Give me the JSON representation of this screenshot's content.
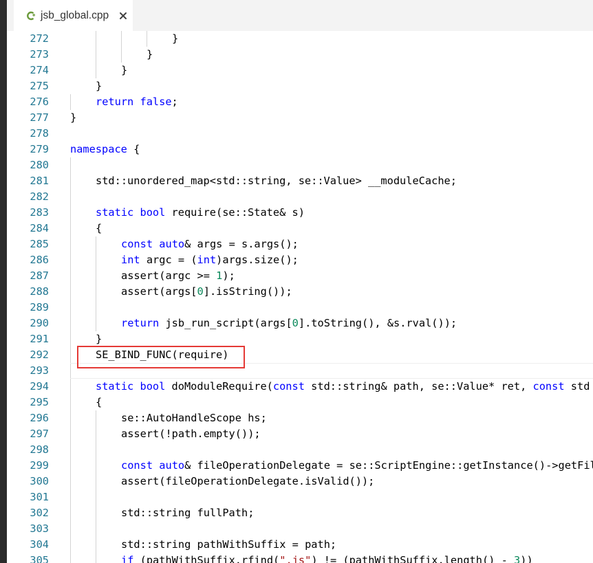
{
  "tab": {
    "filename": "jsb_global.cpp",
    "icon": "cpp-file-icon",
    "close_icon": "close-icon"
  },
  "colors": {
    "keyword": "#0000ff",
    "number": "#09885a",
    "string": "#a31515",
    "line_number": "#237893",
    "highlight_box": "#e53935"
  },
  "editor": {
    "highlighted_line": 292,
    "lines": [
      {
        "n": "272",
        "indent": 4,
        "t": [
          [
            "}",
            ""
          ]
        ]
      },
      {
        "n": "273",
        "indent": 3,
        "t": [
          [
            "}",
            ""
          ]
        ]
      },
      {
        "n": "274",
        "indent": 2,
        "t": [
          [
            "}",
            ""
          ]
        ]
      },
      {
        "n": "275",
        "indent": 1,
        "t": [
          [
            "}",
            ""
          ]
        ]
      },
      {
        "n": "276",
        "indent": 1,
        "t": [
          [
            "return",
            "kw"
          ],
          [
            " ",
            ""
          ],
          [
            "false",
            "kw"
          ],
          [
            ";",
            ""
          ]
        ]
      },
      {
        "n": "277",
        "indent": 0,
        "t": [
          [
            "}",
            ""
          ]
        ]
      },
      {
        "n": "278",
        "indent": 0,
        "t": []
      },
      {
        "n": "279",
        "indent": 0,
        "t": [
          [
            "namespace",
            "kw"
          ],
          [
            " {",
            ""
          ]
        ]
      },
      {
        "n": "280",
        "indent": 0,
        "t": []
      },
      {
        "n": "281",
        "indent": 1,
        "t": [
          [
            "std::unordered_map<std::string, se::Value> __moduleCache;",
            ""
          ]
        ]
      },
      {
        "n": "282",
        "indent": 0,
        "t": []
      },
      {
        "n": "283",
        "indent": 1,
        "t": [
          [
            "static",
            "kw"
          ],
          [
            " ",
            ""
          ],
          [
            "bool",
            "kw"
          ],
          [
            " require(se::State& s)",
            ""
          ]
        ]
      },
      {
        "n": "284",
        "indent": 1,
        "t": [
          [
            "{",
            ""
          ]
        ]
      },
      {
        "n": "285",
        "indent": 2,
        "t": [
          [
            "const",
            "kw"
          ],
          [
            " ",
            ""
          ],
          [
            "auto",
            "kw"
          ],
          [
            "& args = s.args();",
            ""
          ]
        ]
      },
      {
        "n": "286",
        "indent": 2,
        "t": [
          [
            "int",
            "kw"
          ],
          [
            " argc = (",
            ""
          ],
          [
            "int",
            "kw"
          ],
          [
            ")args.size();",
            ""
          ]
        ]
      },
      {
        "n": "287",
        "indent": 2,
        "t": [
          [
            "assert(argc >= ",
            ""
          ],
          [
            "1",
            "num"
          ],
          [
            ");",
            ""
          ]
        ]
      },
      {
        "n": "288",
        "indent": 2,
        "t": [
          [
            "assert(args[",
            ""
          ],
          [
            "0",
            "num"
          ],
          [
            "].isString());",
            ""
          ]
        ]
      },
      {
        "n": "289",
        "indent": 0,
        "t": []
      },
      {
        "n": "290",
        "indent": 2,
        "t": [
          [
            "return",
            "kw"
          ],
          [
            " jsb_run_script(args[",
            ""
          ],
          [
            "0",
            "num"
          ],
          [
            "].toString(), &s.rval());",
            ""
          ]
        ]
      },
      {
        "n": "291",
        "indent": 1,
        "t": [
          [
            "}",
            ""
          ]
        ]
      },
      {
        "n": "292",
        "indent": 1,
        "t": [
          [
            "SE_BIND_FUNC(require)",
            ""
          ]
        ]
      },
      {
        "n": "293",
        "indent": 0,
        "t": []
      },
      {
        "n": "294",
        "indent": 1,
        "t": [
          [
            "static",
            "kw"
          ],
          [
            " ",
            ""
          ],
          [
            "bool",
            "kw"
          ],
          [
            " doModuleRequire(",
            ""
          ],
          [
            "const",
            "kw"
          ],
          [
            " std::string& path, se::Value* ret, ",
            ""
          ],
          [
            "const",
            "kw"
          ],
          [
            " std",
            ""
          ]
        ]
      },
      {
        "n": "295",
        "indent": 1,
        "t": [
          [
            "{",
            ""
          ]
        ]
      },
      {
        "n": "296",
        "indent": 2,
        "t": [
          [
            "se::AutoHandleScope hs;",
            ""
          ]
        ]
      },
      {
        "n": "297",
        "indent": 2,
        "t": [
          [
            "assert(!path.empty());",
            ""
          ]
        ]
      },
      {
        "n": "298",
        "indent": 0,
        "t": []
      },
      {
        "n": "299",
        "indent": 2,
        "t": [
          [
            "const",
            "kw"
          ],
          [
            " ",
            ""
          ],
          [
            "auto",
            "kw"
          ],
          [
            "& fileOperationDelegate = se::ScriptEngine::getInstance()->getFil",
            ""
          ]
        ]
      },
      {
        "n": "300",
        "indent": 2,
        "t": [
          [
            "assert(fileOperationDelegate.isValid());",
            ""
          ]
        ]
      },
      {
        "n": "301",
        "indent": 0,
        "t": []
      },
      {
        "n": "302",
        "indent": 2,
        "t": [
          [
            "std::string fullPath;",
            ""
          ]
        ]
      },
      {
        "n": "303",
        "indent": 0,
        "t": []
      },
      {
        "n": "304",
        "indent": 2,
        "t": [
          [
            "std::string pathWithSuffix = path;",
            ""
          ]
        ]
      },
      {
        "n": "305",
        "indent": 2,
        "t": [
          [
            "if",
            "kw"
          ],
          [
            " (pathWithSuffix.rfind(",
            ""
          ],
          [
            "\".js\"",
            "str"
          ],
          [
            ") != (pathWithSuffix.length() - ",
            ""
          ],
          [
            "3",
            "num"
          ],
          [
            "))",
            ""
          ]
        ]
      }
    ],
    "guide_lines": {
      "272": [
        1,
        2,
        3
      ],
      "273": [
        1,
        2
      ],
      "274": [
        1
      ],
      "275": [],
      "280": [],
      "281": [],
      "282": [],
      "283": [],
      "284": [],
      "285": [
        1
      ],
      "286": [
        1
      ],
      "287": [
        1
      ],
      "288": [
        1
      ],
      "289": [
        1
      ],
      "290": [
        1
      ],
      "291": [],
      "292": [],
      "293": [],
      "294": [],
      "295": [],
      "296": [
        1
      ],
      "297": [
        1
      ],
      "298": [
        1
      ],
      "299": [
        1
      ],
      "300": [
        1
      ],
      "301": [
        1
      ],
      "302": [
        1
      ],
      "303": [
        1
      ],
      "304": [
        1
      ],
      "305": [
        1
      ]
    },
    "scope_guide_lines": [
      "272",
      "273",
      "274",
      "275",
      "276",
      "277"
    ]
  }
}
